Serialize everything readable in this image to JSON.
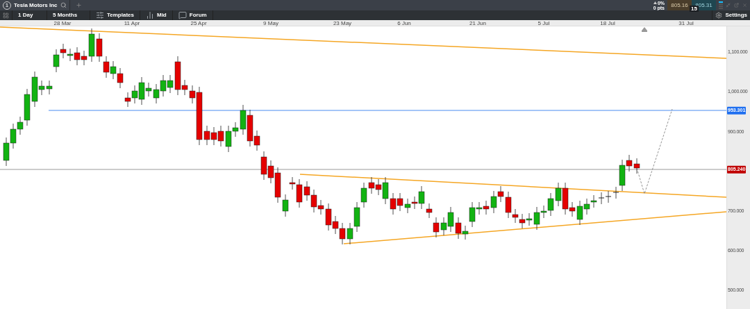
{
  "window": {
    "tab_number": "1",
    "tab_title": "Tesla Motors Inc"
  },
  "quote": {
    "change": "0%",
    "change_points": "0 pts",
    "sell": "805.16",
    "buy": "805.31",
    "spread": "15"
  },
  "toolbar": {
    "items": [
      {
        "kind": "interval",
        "label": "1 Day"
      },
      {
        "kind": "range",
        "label": "5 Months"
      },
      {
        "kind": "templates",
        "label": "Templates"
      },
      {
        "kind": "price",
        "label": "Mid"
      },
      {
        "kind": "forum",
        "label": "Forum"
      }
    ],
    "settings": "Settings"
  },
  "chart": {
    "x_labels": [
      "28 Mar",
      "11 Apr",
      "25 Apr",
      "9 May",
      "23 May",
      "6 Jun",
      "21 Jun",
      "5 Jul",
      "18 Jul",
      "31 Jul"
    ],
    "y_labels": [
      "1,100.000",
      "1,000.000",
      "900.000",
      "700.000",
      "600.000",
      "500.000"
    ],
    "levels": [
      {
        "kind": "line",
        "label": "953.301"
      },
      {
        "kind": "current",
        "label": "805.240"
      }
    ]
  }
}
